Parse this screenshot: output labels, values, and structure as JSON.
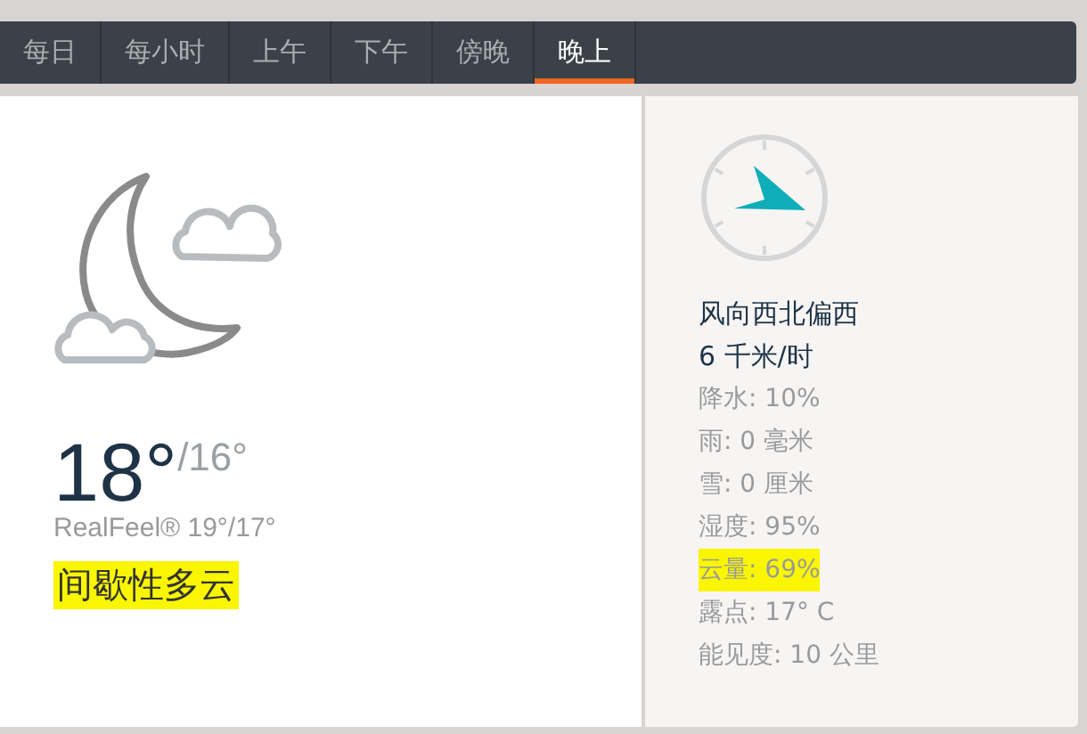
{
  "tabs": [
    {
      "label": "每日",
      "selected": false
    },
    {
      "label": "每小时",
      "selected": false
    },
    {
      "label": "上午",
      "selected": false
    },
    {
      "label": "下午",
      "selected": false
    },
    {
      "label": "傍晚",
      "selected": false
    },
    {
      "label": "晚上",
      "selected": true
    }
  ],
  "current": {
    "temperature": "18°",
    "low": "/16°",
    "realfeel": "RealFeel® 19°/17°",
    "description": "间歇性多云",
    "highlighted": true
  },
  "wind": {
    "direction": "风向西北偏西",
    "speed": "6 千米/时"
  },
  "details": [
    {
      "text": "降水: 10%",
      "highlighted": false
    },
    {
      "text": "雨: 0 毫米",
      "highlighted": false
    },
    {
      "text": "雪: 0 厘米",
      "highlighted": false
    },
    {
      "text": "湿度: 95%",
      "highlighted": false
    },
    {
      "text": "云量: 69%",
      "highlighted": true
    },
    {
      "text": "露点: 17° C",
      "highlighted": false
    },
    {
      "text": "能见度: 10 公里",
      "highlighted": false
    }
  ]
}
